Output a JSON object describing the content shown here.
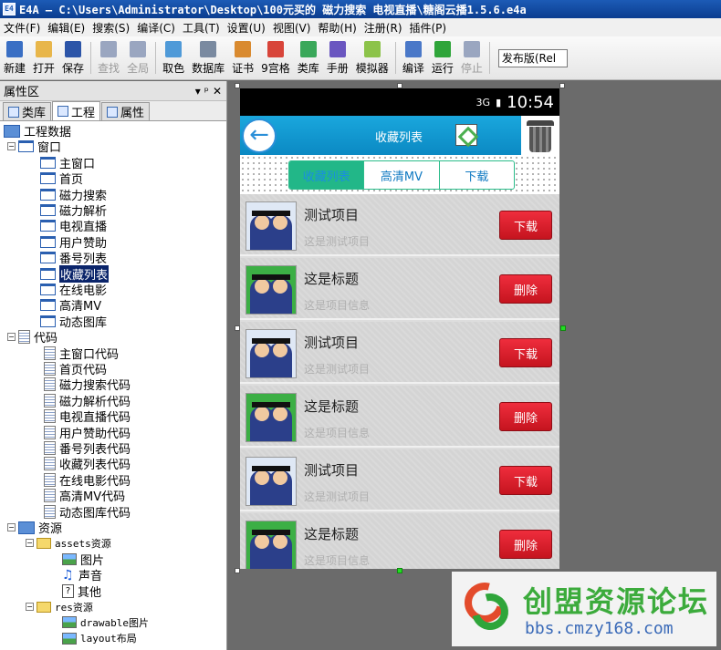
{
  "window": {
    "title": "E4A — C:\\Users\\Administrator\\Desktop\\100元买的 磁力搜索 电视直播\\糖阁云播1.5.6.e4a",
    "app_icon_label": "E4"
  },
  "menu": [
    "文件(F)",
    "编辑(E)",
    "搜索(S)",
    "编译(C)",
    "工具(T)",
    "设置(U)",
    "视图(V)",
    "帮助(H)",
    "注册(R)",
    "插件(P)"
  ],
  "toolbar": {
    "buttons": [
      {
        "label": "新建",
        "color": "#3a6fc4",
        "disabled": false
      },
      {
        "label": "打开",
        "color": "#e8b64a",
        "disabled": false
      },
      {
        "label": "保存",
        "color": "#2c55a8",
        "disabled": false
      },
      {
        "label": "查找",
        "color": "#9aa6c0",
        "disabled": true
      },
      {
        "label": "全局",
        "color": "#9aa6c0",
        "disabled": true
      },
      {
        "label": "取色",
        "color": "#4f9ad8",
        "disabled": false
      },
      {
        "label": "数据库",
        "color": "#7a8aa0",
        "disabled": false
      },
      {
        "label": "证书",
        "color": "#d98a2f",
        "disabled": false
      },
      {
        "label": "9宫格",
        "color": "#d8453a",
        "disabled": false
      },
      {
        "label": "类库",
        "color": "#3aa85a",
        "disabled": false
      },
      {
        "label": "手册",
        "color": "#6a56c0",
        "disabled": false
      },
      {
        "label": "模拟器",
        "color": "#8cc34a",
        "disabled": false
      },
      {
        "label": "编译",
        "color": "#4a78c8",
        "disabled": false
      },
      {
        "label": "运行",
        "color": "#2fa53a",
        "disabled": false
      },
      {
        "label": "停止",
        "color": "#9aa6c0",
        "disabled": true
      }
    ],
    "build_mode": "发布版(Rel"
  },
  "panel": {
    "title": "属性区",
    "controls": [
      "▾",
      "ᵖ",
      "✕"
    ],
    "tabs": [
      "类库",
      "工程",
      "属性"
    ]
  },
  "tree": {
    "root": "工程数据",
    "window_group": "窗口",
    "windows": [
      "主窗口",
      "首页",
      "磁力搜索",
      "磁力解析",
      "电视直播",
      "用户赞助",
      "番号列表",
      "收藏列表",
      "在线电影",
      "高清MV",
      "动态图库"
    ],
    "selected": "收藏列表",
    "code_group": "代码",
    "codes": [
      "主窗口代码",
      "首页代码",
      "磁力搜索代码",
      "磁力解析代码",
      "电视直播代码",
      "用户赞助代码",
      "番号列表代码",
      "收藏列表代码",
      "在线电影代码",
      "高清MV代码",
      "动态图库代码"
    ],
    "res_group": "资源",
    "assets": "assets资源",
    "assets_items": [
      "图片",
      "声音",
      "其他"
    ],
    "res": "res资源",
    "res_items": [
      "drawable图片",
      "layout布局"
    ]
  },
  "phone": {
    "signal": "3G",
    "time": "10:54",
    "title": "收藏列表",
    "tabs": [
      "收藏列表",
      "高清MV",
      "下载"
    ],
    "rows": [
      {
        "title": "测试项目",
        "subtitle": "这是测试项目",
        "button": "下载",
        "thumb": "blue"
      },
      {
        "title": "这是标题",
        "subtitle": "这是项目信息",
        "button": "删除",
        "thumb": "green"
      },
      {
        "title": "测试项目",
        "subtitle": "这是测试项目",
        "button": "下载",
        "thumb": "blue"
      },
      {
        "title": "这是标题",
        "subtitle": "这是项目信息",
        "button": "删除",
        "thumb": "green"
      },
      {
        "title": "测试项目",
        "subtitle": "这是测试项目",
        "button": "下载",
        "thumb": "blue"
      },
      {
        "title": "这是标题",
        "subtitle": "这是项目信息",
        "button": "删除",
        "thumb": "green"
      }
    ]
  },
  "watermark": {
    "name": "创盟资源论坛",
    "url": "bbs.cmzy168.com"
  }
}
